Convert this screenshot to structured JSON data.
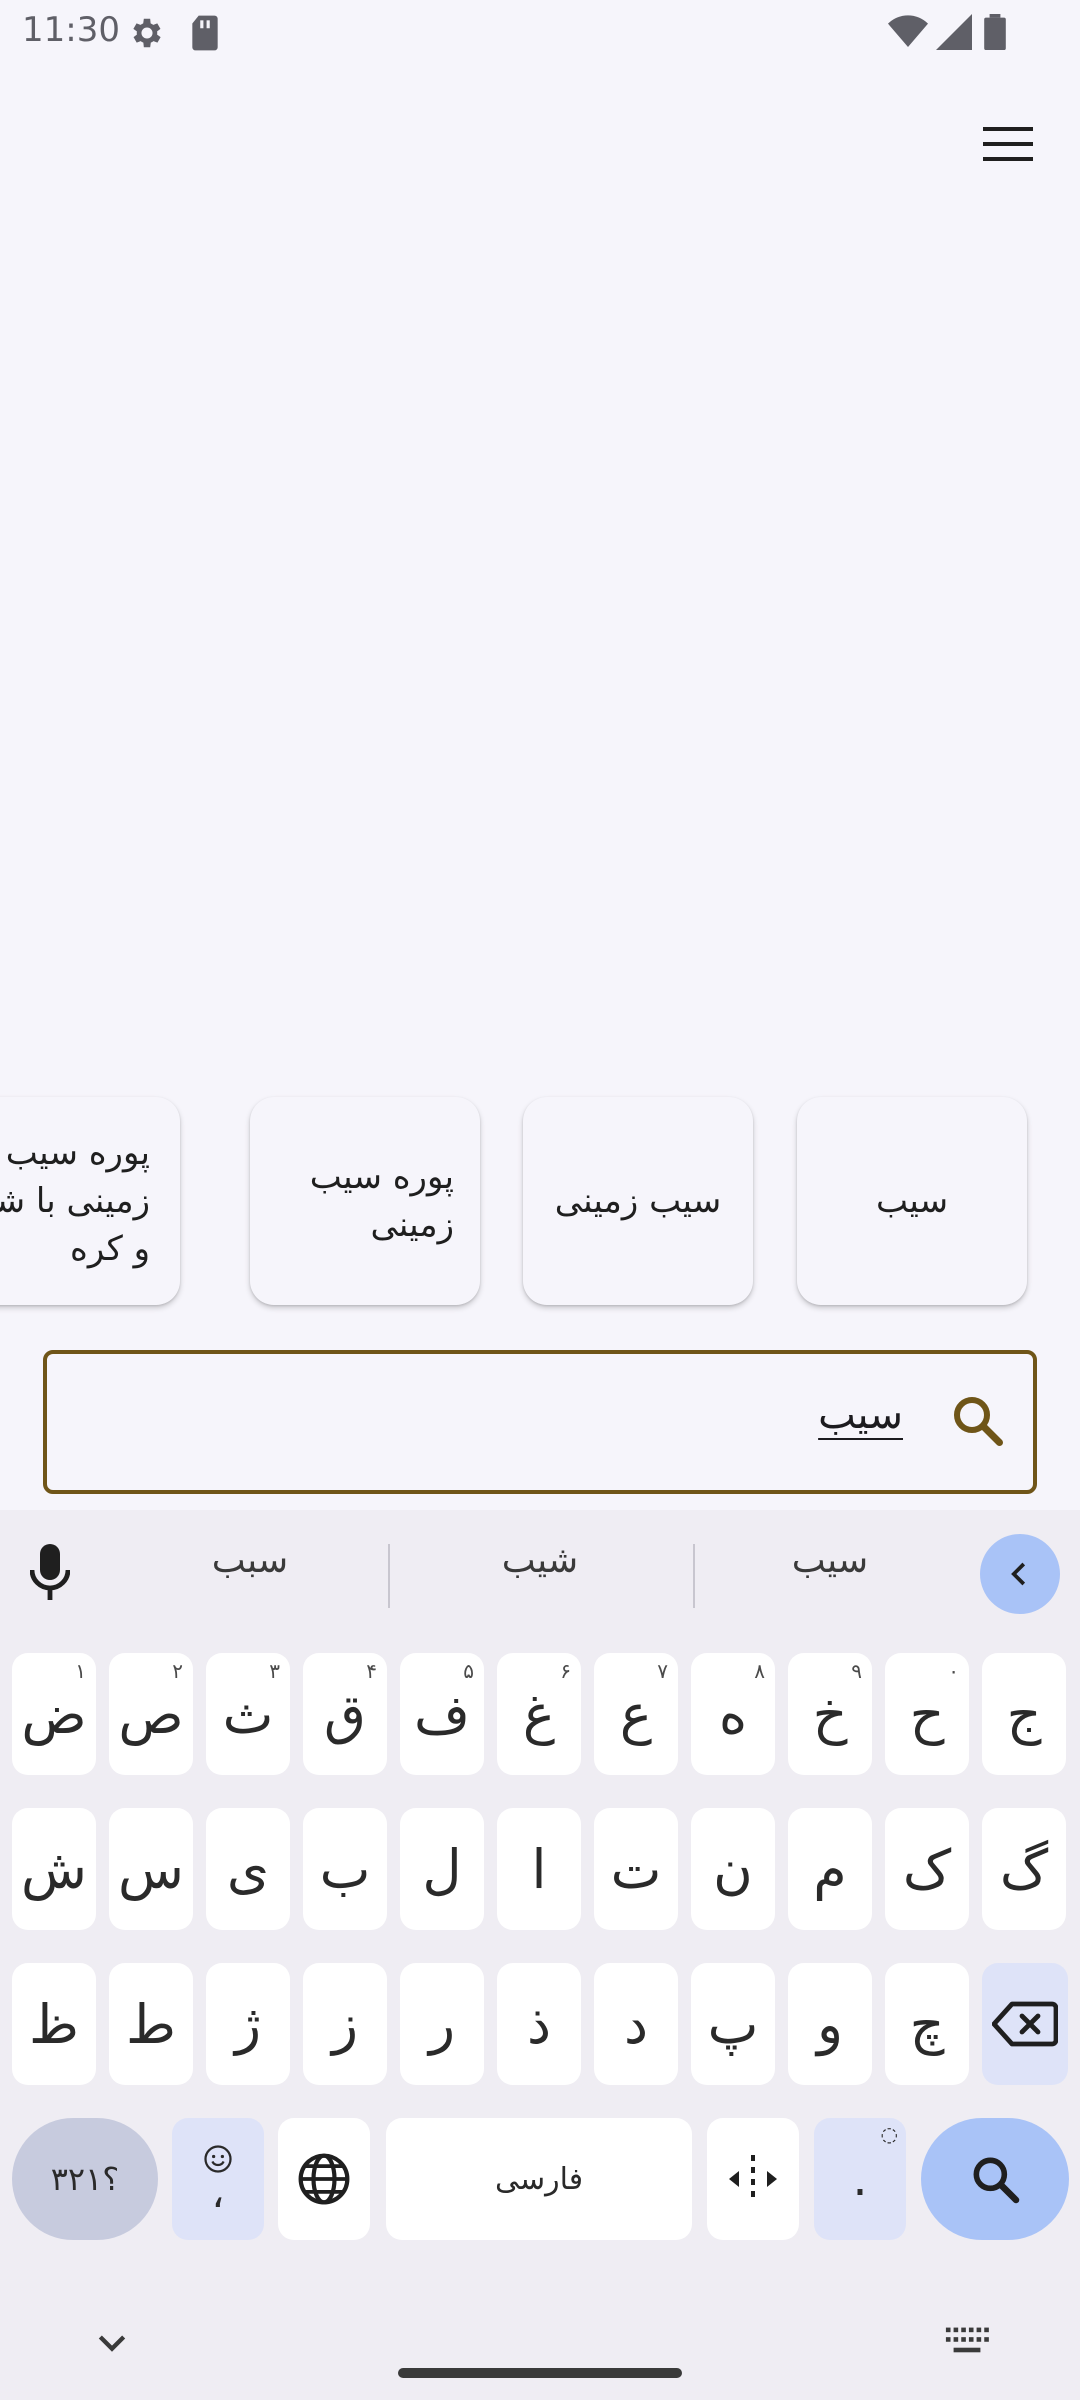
{
  "status_bar": {
    "time": "11:30"
  },
  "suggestion_cards": [
    {
      "label": "سیب"
    },
    {
      "label": "سیب زمینی"
    },
    {
      "label": "پوره سیب زمینی"
    },
    {
      "label": "پوره سیب زمینی با شیر و کره"
    }
  ],
  "search": {
    "value": "سیب"
  },
  "keyboard": {
    "suggestions": [
      "سیب",
      "شیب",
      "سبب"
    ],
    "row1": [
      {
        "key": "ض",
        "hint": "۱"
      },
      {
        "key": "ص",
        "hint": "۲"
      },
      {
        "key": "ث",
        "hint": "۳"
      },
      {
        "key": "ق",
        "hint": "۴"
      },
      {
        "key": "ف",
        "hint": "۵"
      },
      {
        "key": "غ",
        "hint": "۶"
      },
      {
        "key": "ع",
        "hint": "۷"
      },
      {
        "key": "ه",
        "hint": "۸"
      },
      {
        "key": "خ",
        "hint": "۹"
      },
      {
        "key": "ح",
        "hint": "۰"
      },
      {
        "key": "ج",
        "hint": ""
      }
    ],
    "row2": [
      "ش",
      "س",
      "ی",
      "ب",
      "ل",
      "ا",
      "ت",
      "ن",
      "م",
      "ک",
      "گ"
    ],
    "row3": [
      "ظ",
      "ط",
      "ژ",
      "ز",
      "ر",
      "ذ",
      "د",
      "پ",
      "و",
      "چ"
    ],
    "numbers_key": "؟۳۲۱",
    "emoji_comma": "،",
    "space_label": "فارسی",
    "period_key": ".",
    "accent_color": "#a9c3f7",
    "function_key_color": "#dee3f8"
  }
}
